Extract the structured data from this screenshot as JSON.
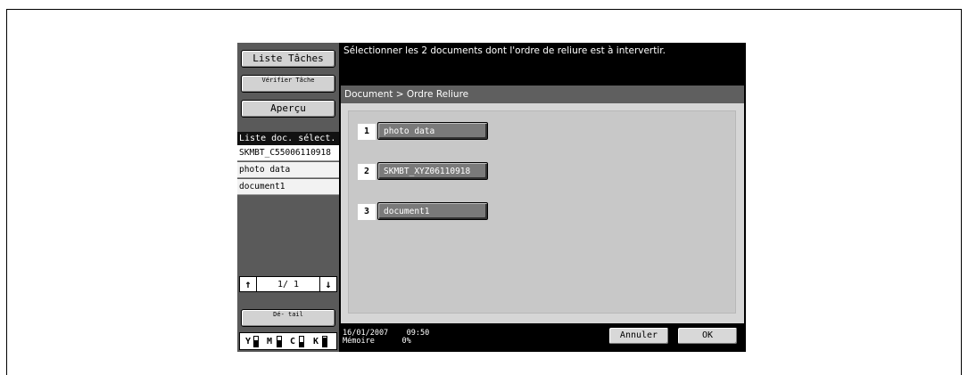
{
  "sidebar": {
    "buttons": {
      "job_list": "Liste Tâches",
      "check_job": "Vérifier Tâche",
      "preview": "Aperçu",
      "detail": "Dé- tail"
    },
    "list_header": "Liste doc. sélect.",
    "items": [
      "SKMBT_C55006110918",
      "photo data",
      "document1"
    ],
    "pager": {
      "page": "1/ 1",
      "up_icon": "up-arrow-icon",
      "down_icon": "down-arrow-icon"
    },
    "toner": [
      {
        "label": "Y",
        "level": 0.6
      },
      {
        "label": "M",
        "level": 0.6
      },
      {
        "label": "C",
        "level": 0.5
      },
      {
        "label": "K",
        "level": 0.9
      }
    ]
  },
  "message": "Sélectionner les 2 documents dont l'ordre de reliure est à intervertir.",
  "main": {
    "breadcrumb": "Document > Ordre Reliure",
    "documents": [
      {
        "number": "1",
        "name": "photo data"
      },
      {
        "number": "2",
        "name": "SKMBT_XYZ06110918"
      },
      {
        "number": "3",
        "name": "document1"
      }
    ]
  },
  "footer": {
    "datetime": "16/01/2007    09:50",
    "memory_label": "Mémoire",
    "memory_value": "0%",
    "cancel": "Annuler",
    "ok": "OK"
  },
  "colors": {
    "screen_bg": "#000000",
    "panel_gray": "#5a5a5a",
    "content_bg": "#d6d6d6",
    "doc_button": "#7a7a7a"
  }
}
